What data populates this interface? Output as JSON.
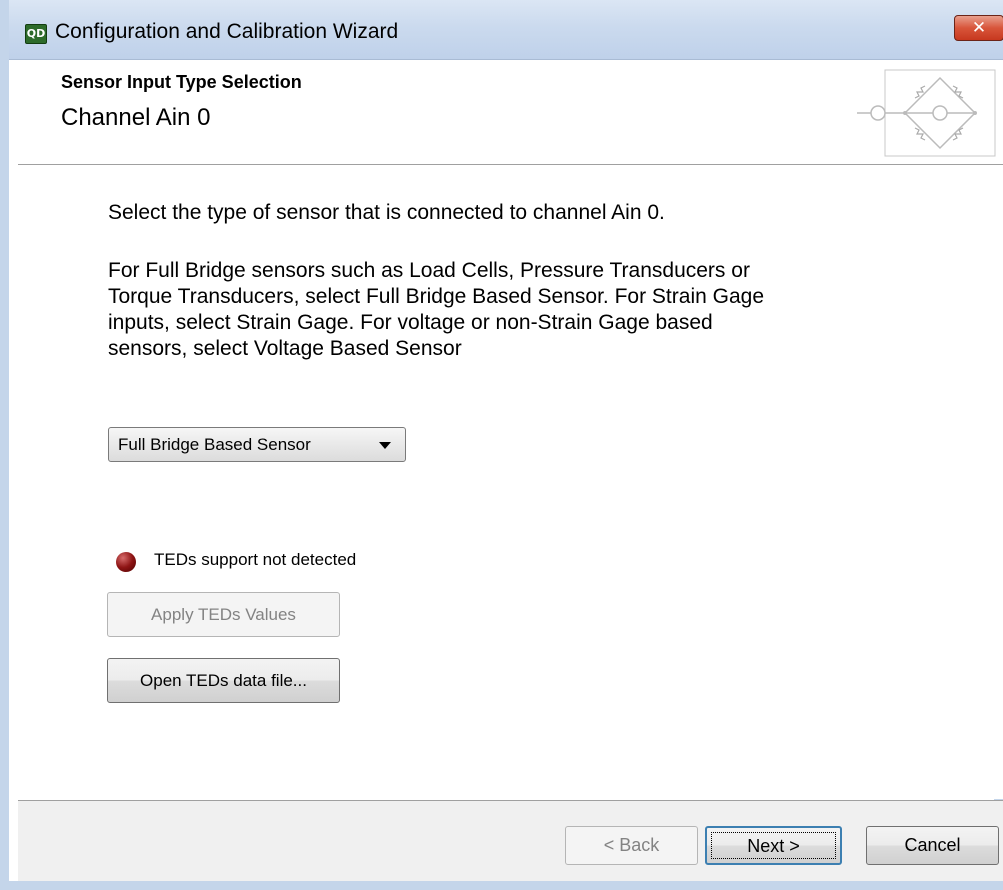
{
  "window": {
    "title": "Configuration and Calibration Wizard",
    "app_icon_text": "QD",
    "close_glyph": "✕"
  },
  "header": {
    "subtitle": "Sensor Input Type Selection",
    "title": "Channel Ain 0",
    "diagram_icon": "wheatstone-bridge-icon"
  },
  "content": {
    "instruction": "Select the type of sensor that is connected to channel Ain 0.",
    "help_lines": [
      "For Full Bridge sensors such as Load Cells, Pressure Transducers or",
      "Torque Transducers, select Full Bridge Based Sensor.  For Strain Gage",
      "inputs, select Strain Gage.  For voltage or non-Strain Gage based",
      "sensors, select Voltage Based Sensor"
    ],
    "sensor_type_selected": "Full Bridge Based Sensor",
    "ted_status_text": "TEDs support not detected",
    "ted_status_color": "#8e1414",
    "apply_teds_label": "Apply TEDs Values",
    "apply_teds_enabled": false,
    "open_teds_label": "Open TEDs data file..."
  },
  "footer": {
    "back_label": "< Back",
    "back_enabled": false,
    "next_label": "Next >",
    "cancel_label": "Cancel"
  }
}
